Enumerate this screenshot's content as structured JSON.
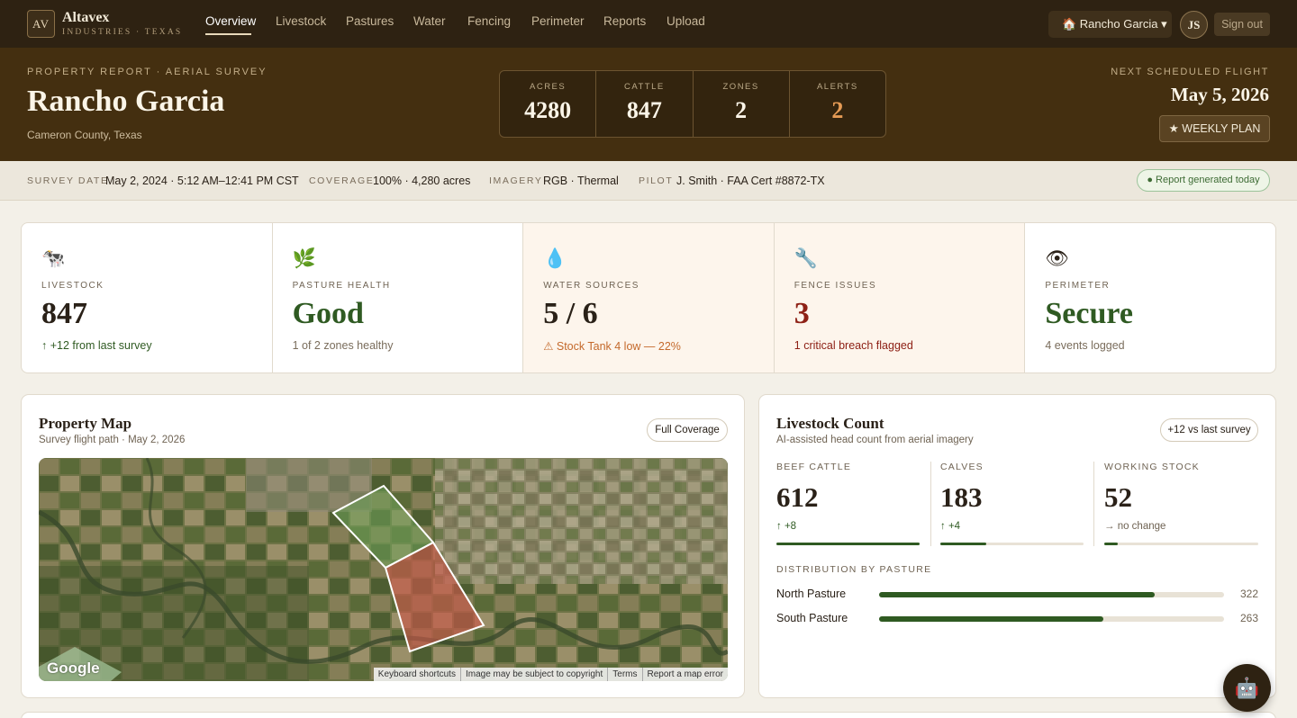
{
  "brand": {
    "monogram": "AV",
    "name": "Altavex",
    "tagline": "INDUSTRIES · TEXAS"
  },
  "nav": {
    "items": [
      {
        "label": "Overview",
        "active": true
      },
      {
        "label": "Livestock"
      },
      {
        "label": "Pastures"
      },
      {
        "label": "Water"
      },
      {
        "label": "Fencing"
      },
      {
        "label": "Perimeter"
      },
      {
        "label": "Reports"
      },
      {
        "label": "Upload"
      }
    ],
    "property_select": "🏠 Rancho Garcia ▾",
    "avatar_initials": "JS",
    "signout": "Sign out"
  },
  "hero": {
    "eyebrow": "PROPERTY REPORT · AERIAL SURVEY",
    "title": "Rancho Garcia",
    "location": "Cameron County, Texas",
    "stats": [
      {
        "label": "ACRES",
        "value": "4280"
      },
      {
        "label": "CATTLE",
        "value": "847"
      },
      {
        "label": "ZONES",
        "value": "2"
      },
      {
        "label": "ALERTS",
        "value": "2"
      }
    ],
    "next_flight_label": "NEXT SCHEDULED FLIGHT",
    "next_flight_date": "May 5, 2026",
    "plan_button": "★ WEEKLY PLAN"
  },
  "strip": {
    "survey_date_label": "SURVEY DATE",
    "survey_date": "May 2, 2024 · 5:12 AM–12:41 PM CST",
    "coverage_label": "COVERAGE",
    "coverage": "100% · 4,280 acres",
    "imagery_label": "IMAGERY",
    "imagery": "RGB · Thermal",
    "pilot_label": "PILOT",
    "pilot": "J. Smith · FAA Cert #8872-TX",
    "badge": "● Report generated today"
  },
  "kpis": [
    {
      "icon": "cow-icon",
      "glyph": "🐄",
      "label": "LIVESTOCK",
      "value": "847",
      "sub": "↑ +12 from last survey"
    },
    {
      "icon": "leaf-icon",
      "glyph": "🌿",
      "label": "PASTURE HEALTH",
      "value": "Good",
      "sub": "1 of 2 zones healthy"
    },
    {
      "icon": "water-drop-icon",
      "glyph": "💧",
      "label": "WATER SOURCES",
      "value": "5 / 6",
      "sub": "⚠ Stock Tank 4 low — 22%"
    },
    {
      "icon": "wrench-icon",
      "glyph": "🔧",
      "label": "FENCE ISSUES",
      "value": "3",
      "sub": "1 critical breach flagged"
    },
    {
      "icon": "eye-icon",
      "glyph": "👁",
      "label": "PERIMETER",
      "value": "Secure",
      "sub": "4 events logged"
    }
  ],
  "map_panel": {
    "title": "Property Map",
    "subtitle": "Survey flight path · May 2, 2026",
    "pill": "Full Coverage",
    "google": "Google",
    "attribution": [
      "Keyboard shortcuts",
      "Image may be subject to copyright",
      "Terms",
      "Report a map error"
    ],
    "zone_colors": {
      "north": "#6fa35a",
      "south": "#c8584a"
    }
  },
  "livestock_panel": {
    "title": "Livestock Count",
    "subtitle": "AI-assisted head count from aerial imagery",
    "pill": "+12 vs last survey",
    "columns": [
      {
        "label": "BEEF CATTLE",
        "value": "612",
        "delta": "↑ +8",
        "fill": 1.0
      },
      {
        "label": "CALVES",
        "value": "183",
        "delta": "↑ +4",
        "fill": 0.32
      },
      {
        "label": "WORKING STOCK",
        "value": "52",
        "delta": "→ no change",
        "fill": 0.09
      }
    ],
    "distribution_title": "DISTRIBUTION BY PASTURE",
    "distribution": [
      {
        "name": "North Pasture",
        "value": "322",
        "fill": 0.8
      },
      {
        "name": "South Pasture",
        "value": "263",
        "fill": 0.65
      }
    ]
  },
  "assistant_glyph": "🤖"
}
